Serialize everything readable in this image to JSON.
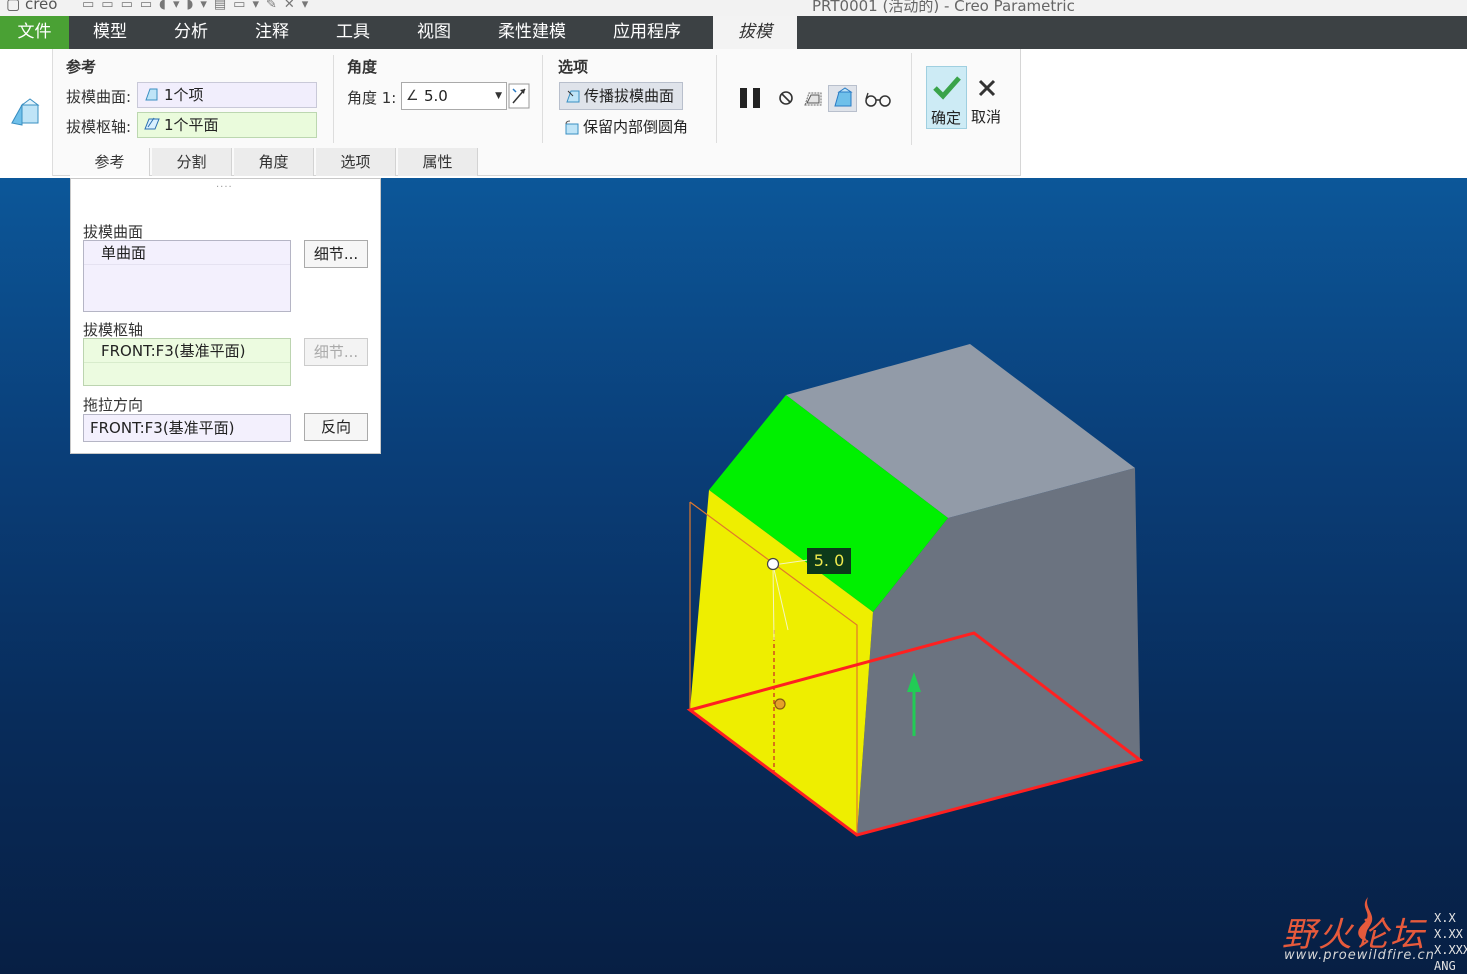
{
  "window": {
    "app_name": "creo",
    "title": "PRT0001 (活动的) - Creo Parametric"
  },
  "menu": {
    "file": "文件",
    "items": [
      "模型",
      "分析",
      "注释",
      "工具",
      "视图",
      "柔性建模",
      "应用程序"
    ],
    "active_tab": "拔模"
  },
  "ribbon": {
    "references": {
      "title": "参考",
      "draft_surface_label": "拔模曲面:",
      "draft_surface_value": "1个项",
      "draft_hinge_label": "拔模枢轴:",
      "draft_hinge_value": "1个平面"
    },
    "angle": {
      "title": "角度",
      "angle_label": "角度 1:",
      "angle_value": "5.0"
    },
    "options": {
      "title": "选项",
      "propagate_label": "传播拔模曲面",
      "keep_fillets_label": "保留内部倒圆角"
    },
    "ok_label": "确定",
    "cancel_label": "取消",
    "tabs": [
      "参考",
      "分割",
      "角度",
      "选项",
      "属性"
    ],
    "active_tab_index": 0
  },
  "ref_panel": {
    "grip": "....",
    "draft_surfaces_label": "拔模曲面",
    "draft_surfaces_items": [
      "单曲面"
    ],
    "details_label": "细节...",
    "draft_hinges_label": "拔模枢轴",
    "draft_hinges_items": [
      "FRONT:F3(基准平面)"
    ],
    "pull_direction_label": "拖拉方向",
    "pull_direction_value": "FRONT:F3(基准平面)",
    "flip_label": "反向"
  },
  "viewport": {
    "dimension_label": "5. 0",
    "colors": {
      "draft_surface": "#eeee00",
      "top_face": "#00f000",
      "side_face": "#6b7380",
      "top_back_face": "#929ba8",
      "hinge_outline": "#ff2020",
      "pull_arrow": "#22cc55"
    }
  },
  "watermark": {
    "brand": "野火论坛",
    "url": "www.proewildfire.cn"
  },
  "coords": [
    "X.X",
    "X.XX",
    "X.XXX",
    "ANG"
  ]
}
